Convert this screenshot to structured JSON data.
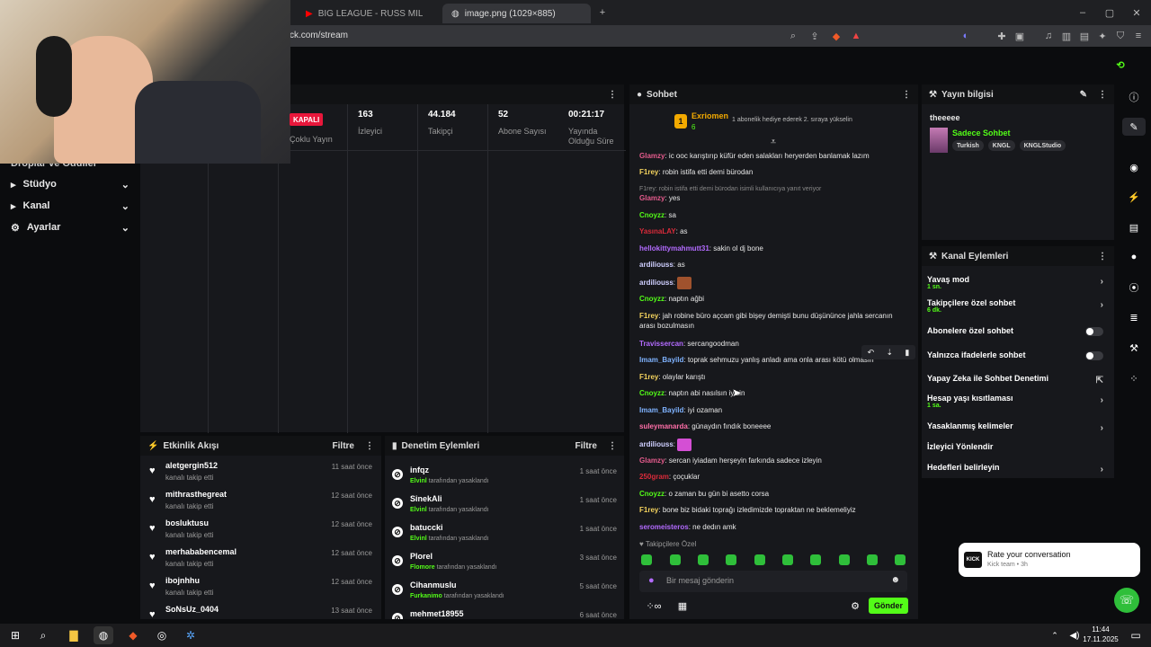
{
  "browser": {
    "tabs": [
      {
        "label": "BIG LEAGUE - RUSS MİLLIONS X"
      },
      {
        "label": "image.png (1029×885)"
      }
    ],
    "new_tab_label": "+",
    "url": "ck.com/stream"
  },
  "sidebar": {
    "items": [
      {
        "label": "Droplar ve Ödüller"
      },
      {
        "label": "Stüdyo"
      },
      {
        "label": "Kanal"
      },
      {
        "label": "Ayarlar"
      }
    ]
  },
  "stats": {
    "status_badge": "KAPALI",
    "status_label": "Çoklu Yayın",
    "items": [
      {
        "value": "163",
        "label": "İzleyici"
      },
      {
        "value": "44.184",
        "label": "Takipçi"
      },
      {
        "value": "52",
        "label": "Abone Sayısı"
      },
      {
        "value": "00:21:17",
        "label": "Yayında Olduğu Süre"
      }
    ]
  },
  "activity": {
    "title": "Etkinlik Akışı",
    "filter_label": "Filtre",
    "items": [
      {
        "name": "aletgergin512",
        "sub": "kanalı takip etti",
        "time": "11 saat önce"
      },
      {
        "name": "mithrasthegreat",
        "sub": "kanalı takip etti",
        "time": "12 saat önce"
      },
      {
        "name": "bosluktusu",
        "sub": "kanalı takip etti",
        "time": "12 saat önce"
      },
      {
        "name": "merhababencemal",
        "sub": "kanalı takip etti",
        "time": "12 saat önce"
      },
      {
        "name": "ibojnhhu",
        "sub": "kanalı takip etti",
        "time": "12 saat önce"
      },
      {
        "name": "SoNsUz_0404",
        "sub": "",
        "time": "13 saat önce"
      }
    ]
  },
  "moderation": {
    "title": "Denetim Eylemleri",
    "filter_label": "Filtre",
    "items": [
      {
        "name": "infqz",
        "by": "Elvinl",
        "sub": "tarafından yasaklandı",
        "time": "1 saat önce"
      },
      {
        "name": "SinekAli",
        "by": "Elvinl",
        "sub": "tarafından yasaklandı",
        "time": "1 saat önce"
      },
      {
        "name": "batuccki",
        "by": "Elvinl",
        "sub": "tarafından yasaklandı",
        "time": "1 saat önce"
      },
      {
        "name": "Plorel",
        "by": "Flomore",
        "sub": "tarafından yasaklandı",
        "time": "3 saat önce"
      },
      {
        "name": "Cihanmuslu",
        "by": "Furkanimo",
        "sub": "tarafından yasaklandı",
        "time": "5 saat önce"
      },
      {
        "name": "mehmet18955",
        "by": "",
        "sub": "",
        "time": "6 saat önce"
      }
    ]
  },
  "chat": {
    "title": "Sohbet",
    "pinned_user": "Exriomen",
    "pinned_rank": "1",
    "pinned_count": "6",
    "pinned_text": "1 abonelik hediye ederek 2. sıraya yükselin",
    "messages": [
      {
        "user": "Glamzy",
        "text": "ic ooc karıştırıp küfür eden salakları heryerden banlamak lazım",
        "color": "#e45b8c"
      },
      {
        "user": "F1rey",
        "text": "robin istifa etti demi bürodan",
        "color": "#f4d35e"
      },
      {
        "user": "",
        "text": "F1rey: robin istifa etti demi bürodan isimli kullanıcıya yanıt veriyor",
        "color": "#888888"
      },
      {
        "user": "Glamzy",
        "text": "yes",
        "color": "#e45b8c"
      },
      {
        "user": "Cnoyzz",
        "text": "sa",
        "color": "#53fc18"
      },
      {
        "user": "YasınaLAY",
        "text": "as",
        "color": "#d92b3a"
      },
      {
        "user": "hellokittymahmutt31",
        "text": "sakin ol dj bone",
        "color": "#b36bff"
      },
      {
        "user": "ardiliouss",
        "text": "as",
        "color": "#cfcfff"
      },
      {
        "user": "ardiliouss",
        "text": "",
        "color": "#cfcfff"
      },
      {
        "user": "Cnoyzz",
        "text": "naptın ağbi",
        "color": "#53fc18"
      },
      {
        "user": "F1rey",
        "text": "jah robine büro açcam gibi bişey demişti bunu düşününce jahla sercanın arası bozulmasın",
        "color": "#f4d35e"
      },
      {
        "user": "Travissercan",
        "text": "sercangoodman",
        "color": "#b36bff"
      },
      {
        "user": "Imam_Bayild",
        "text": "toprak sehmuzu yanlış anladı ama onla arası kötü olmasın",
        "color": "#7fb3ff"
      },
      {
        "user": "F1rey",
        "text": "olaylar karıştı",
        "color": "#f4d35e"
      },
      {
        "user": "Cnoyzz",
        "text": "naptın abi nasılsın iyisin",
        "color": "#53fc18"
      },
      {
        "user": "Imam_Bayild",
        "text": "iyi ozaman",
        "color": "#7fb3ff"
      },
      {
        "user": "suleymanarda",
        "text": "günaydın fındık boneeee",
        "color": "#ff6fa8"
      },
      {
        "user": "ardiliouss",
        "text": "",
        "color": "#cfcfff"
      },
      {
        "user": "Glamzy",
        "text": "sercan iyiadam herşeyin farkında sadece izleyin",
        "color": "#e45b8c"
      },
      {
        "user": "250gram",
        "text": "çoçuklar",
        "color": "#d92b3a"
      },
      {
        "user": "Cnoyzz",
        "text": "o zaman bu gün bi asetto corsa",
        "color": "#53fc18"
      },
      {
        "user": "F1rey",
        "text": "bone biz bidaki toprağı izledimizde topraktan ne beklemeliyiz",
        "color": "#f4d35e"
      },
      {
        "user": "seromeisteros",
        "text": "ne dedın amk",
        "color": "#b36bff"
      }
    ],
    "followers_only_label": "Takipçilere Özel",
    "input_placeholder": "Bir mesaj gönderin",
    "send_label": "Gönder"
  },
  "stream_info": {
    "title": "Yayın bilgisi",
    "stream_title": "theeeee",
    "category": "Sadece Sohbet",
    "tags": [
      "Turkish",
      "KNGL",
      "KNGLStudio"
    ]
  },
  "channel_actions": {
    "title": "Kanal Eylemleri",
    "items": [
      {
        "label": "Yavaş mod",
        "sub": "1 sn.",
        "control": "chevron"
      },
      {
        "label": "Takipçilere özel sohbet",
        "sub": "6 dk.",
        "control": "chevron"
      },
      {
        "label": "Abonelere özel sohbet",
        "sub": "",
        "control": "toggle"
      },
      {
        "label": "Yalnızca ifadelerle sohbet",
        "sub": "",
        "control": "toggle"
      },
      {
        "label": "Yapay Zeka ile Sohbet Denetimi",
        "sub": "",
        "control": "external"
      },
      {
        "label": "Hesap yaşı kısıtlaması",
        "sub": "1 sa.",
        "control": "chevron"
      },
      {
        "label": "Yasaklanmış kelimeler",
        "sub": "",
        "control": "chevron"
      },
      {
        "label": "İzleyici Yönlendir",
        "sub": "",
        "control": "none"
      },
      {
        "label": "Hedefleri belirleyin",
        "sub": "",
        "control": "chevron"
      }
    ]
  },
  "toast": {
    "title": "Rate your conversation",
    "sub": "Kick team • 3h",
    "logo": "KICK"
  },
  "taskbar": {
    "time": "11:44",
    "date": "17.11.2025"
  },
  "colors": {
    "accent": "#53fc18",
    "panel": "#17181c",
    "badge": "#e8173b"
  }
}
